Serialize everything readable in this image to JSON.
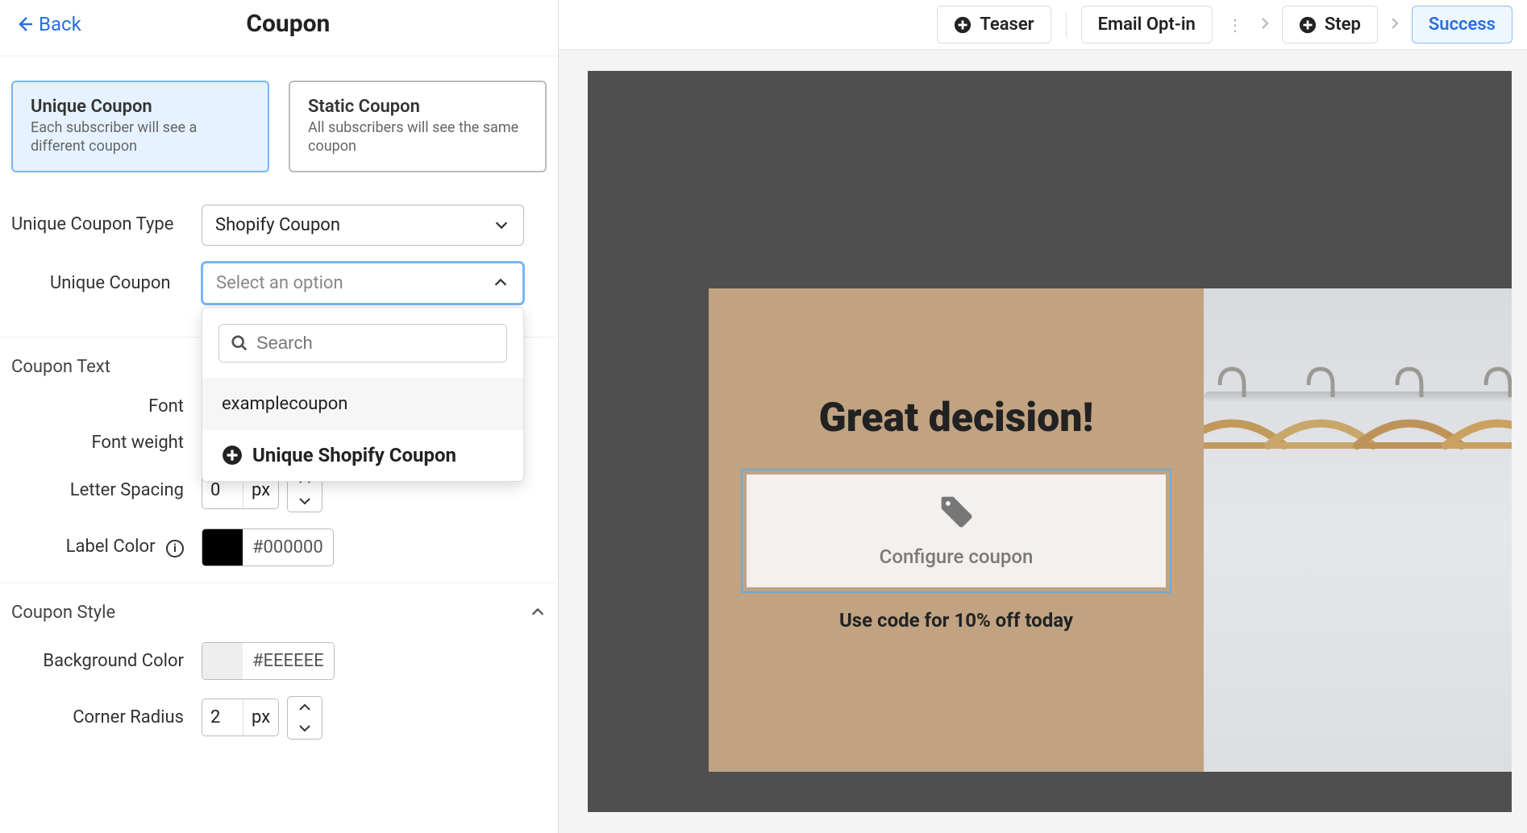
{
  "header": {
    "back_label": "Back",
    "title": "Coupon"
  },
  "coupon_types": {
    "unique": {
      "title": "Unique Coupon",
      "desc": "Each subscriber will see a different coupon"
    },
    "static": {
      "title": "Static Coupon",
      "desc": "All subscribers will see the same coupon"
    }
  },
  "form": {
    "unique_type_label": "Unique Coupon Type",
    "unique_type_value": "Shopify Coupon",
    "unique_coupon_label": "Unique Coupon",
    "unique_coupon_placeholder": "Select an option",
    "search_placeholder": "Search",
    "option_0": "examplecoupon",
    "add_option": "Unique Shopify Coupon"
  },
  "coupon_text": {
    "section": "Coupon Text",
    "font_label": "Font",
    "font_weight_label": "Font weight",
    "letter_spacing_label": "Letter Spacing",
    "letter_spacing_value": "0",
    "letter_spacing_unit": "px",
    "label_color_label": "Label Color",
    "label_color_hex": "000000",
    "label_color_hash": "#",
    "label_color_swatch": "#000000"
  },
  "coupon_style": {
    "section": "Coupon Style",
    "bg_color_label": "Background Color",
    "bg_color_hex": "EEEEEE",
    "bg_color_hash": "#",
    "bg_color_swatch": "#EEEEEE",
    "corner_radius_label": "Corner Radius",
    "corner_radius_value": "2",
    "corner_radius_unit": "px"
  },
  "topnav": {
    "teaser": "Teaser",
    "email_optin": "Email Opt-in",
    "step": "Step",
    "success": "Success"
  },
  "preview": {
    "title": "Great decision!",
    "configure": "Configure coupon",
    "subtext": "Use code for 10% off today"
  }
}
